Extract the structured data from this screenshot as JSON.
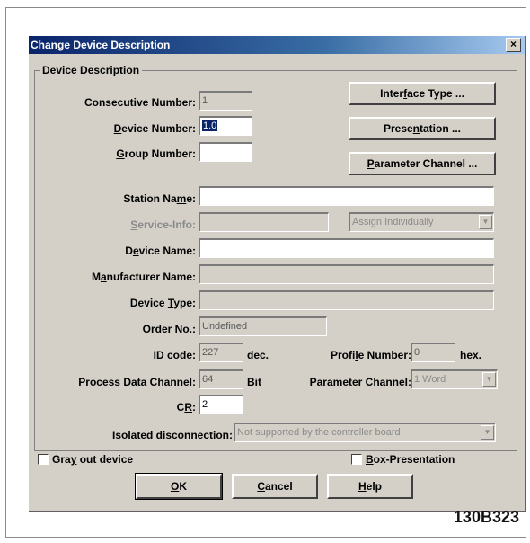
{
  "window": {
    "title": "Change Device Description",
    "close_glyph": "×"
  },
  "group": {
    "title": "Device Description"
  },
  "fields": {
    "consecutive_number": {
      "label": "Consecutive Number:",
      "value": "1"
    },
    "device_number": {
      "label_pre": "",
      "label_u": "D",
      "label_post": "evice Number:",
      "value": "1.0"
    },
    "group_number": {
      "label_pre": "",
      "label_u": "G",
      "label_post": "roup Number:",
      "value": ""
    },
    "station_name": {
      "label_pre": "Station Na",
      "label_u": "m",
      "label_post": "e:",
      "value": ""
    },
    "service_info": {
      "label_pre": "",
      "label_u": "S",
      "label_post": "ervice-Info:",
      "value": "",
      "assign": "Assign Individually"
    },
    "device_name": {
      "label_pre": "D",
      "label_u": "e",
      "label_post": "vice Name:",
      "value": ""
    },
    "manufacturer_name": {
      "label_pre": "M",
      "label_u": "a",
      "label_post": "nufacturer Name:",
      "value": ""
    },
    "device_type": {
      "label_pre": "Device ",
      "label_u": "T",
      "label_post": "ype:",
      "value": ""
    },
    "order_no": {
      "label": "Order No.:",
      "value": "Undefined"
    },
    "id_code": {
      "label": "ID code:",
      "value": "227",
      "unit": "dec."
    },
    "profile_number": {
      "label_pre": "Profi",
      "label_u": "l",
      "label_post": "e Number:",
      "value": "0",
      "unit": "hex."
    },
    "process_data_channel": {
      "label": "Process Data Channel:",
      "value": "64",
      "unit": "Bit"
    },
    "parameter_channel": {
      "label": "Parameter Channel:",
      "value": "1 Word"
    },
    "cr": {
      "label_pre": "C",
      "label_u": "R",
      "label_post": ":",
      "value": "2"
    },
    "isolated_disconnection": {
      "label": "Isolated disconnection:",
      "value": "Not supported by the controller board"
    }
  },
  "buttons": {
    "interface_type": {
      "pre": "Inter",
      "u": "f",
      "post": "ace Type ..."
    },
    "presentation": {
      "pre": "Prese",
      "u": "n",
      "post": "tation ..."
    },
    "parameter_channel": {
      "pre": "",
      "u": "P",
      "post": "arameter Channel ..."
    },
    "ok": {
      "pre": "",
      "u": "O",
      "post": "K"
    },
    "cancel": {
      "pre": "",
      "u": "C",
      "post": "ancel"
    },
    "help": {
      "pre": "",
      "u": "H",
      "post": "elp"
    }
  },
  "checkboxes": {
    "gray_out": {
      "pre": "Gra",
      "u": "y",
      "post": " out device",
      "checked": false
    },
    "box_presentation": {
      "pre": "",
      "u": "B",
      "post": "ox-Presentation",
      "checked": false
    }
  },
  "figure_id": "130B323"
}
